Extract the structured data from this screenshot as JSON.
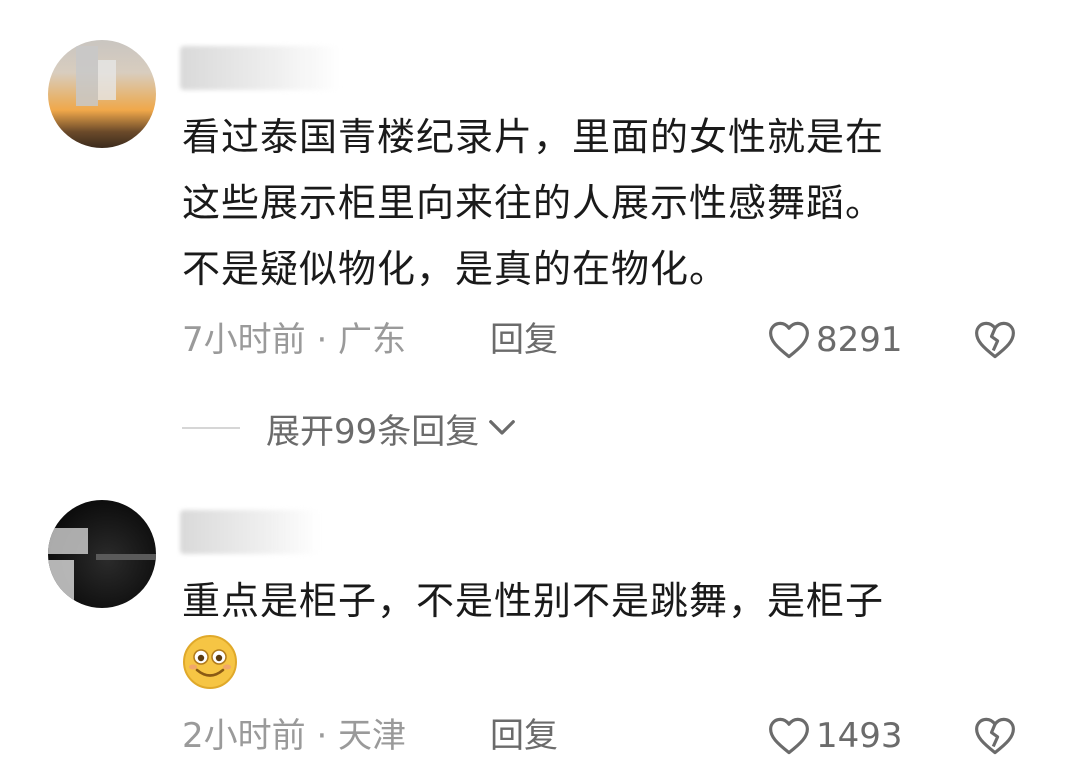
{
  "comments": [
    {
      "text_lines": [
        "看过泰国青楼纪录片，里面的女性就是在",
        "这些展示柜里向来往的人展示性感舞蹈。",
        "不是疑似物化，是真的在物化。"
      ],
      "time_location": "7小时前 · 广东",
      "reply_label": "回复",
      "like_count": "8291",
      "expand_replies_label": "展开99条回复"
    },
    {
      "text_lines": [
        "重点是柜子，不是性别不是跳舞，是柜子"
      ],
      "emoji": "smiling-face-icon",
      "time_location": "2小时前 · 天津",
      "reply_label": "回复",
      "like_count": "1493"
    }
  ],
  "colors": {
    "text": "#1a1a1a",
    "meta": "#9a9a9a",
    "action": "#6b6b6b",
    "background": "#ffffff"
  }
}
